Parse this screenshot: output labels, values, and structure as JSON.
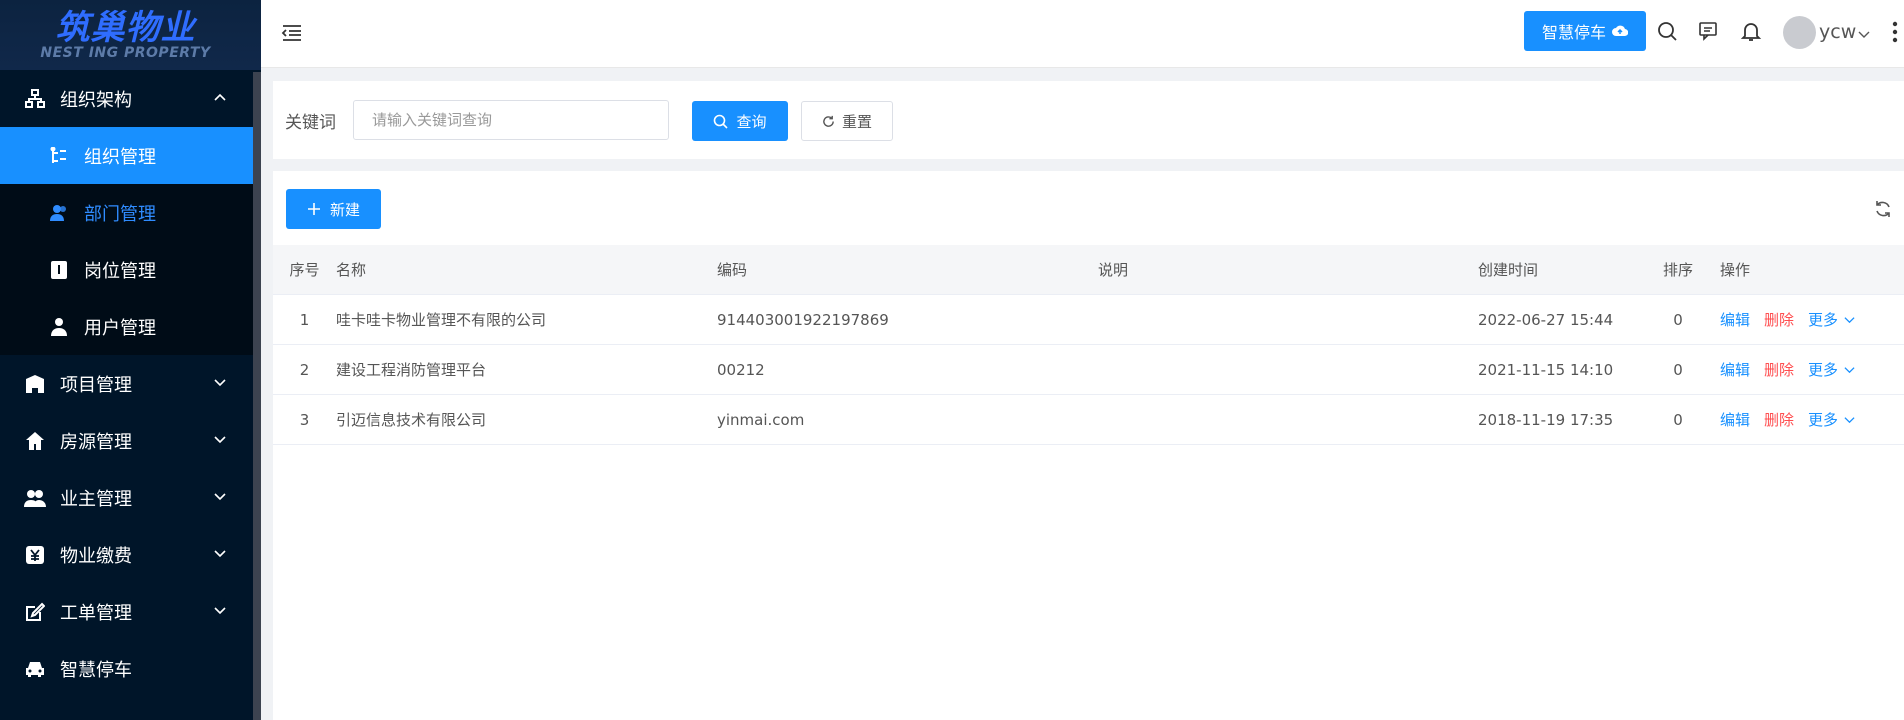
{
  "brand": {
    "logo_cn": "筑巢物业",
    "logo_en": "NEST ING PROPERTY"
  },
  "sidebar": {
    "items": [
      {
        "label": "组织架构",
        "icon": "org-chart-icon",
        "expanded": true
      },
      {
        "label": "组织管理",
        "icon": "tree-icon",
        "active": true
      },
      {
        "label": "部门管理",
        "icon": "users-icon"
      },
      {
        "label": "岗位管理",
        "icon": "badge-icon"
      },
      {
        "label": "用户管理",
        "icon": "user-icon"
      },
      {
        "label": "项目管理",
        "icon": "building-icon"
      },
      {
        "label": "房源管理",
        "icon": "home-icon"
      },
      {
        "label": "业主管理",
        "icon": "owners-icon"
      },
      {
        "label": "物业缴费",
        "icon": "yuan-icon"
      },
      {
        "label": "工单管理",
        "icon": "edit-icon"
      },
      {
        "label": "智慧停车",
        "icon": "car-icon"
      }
    ]
  },
  "header": {
    "park_button": "智慧停车",
    "username": "ycw"
  },
  "search": {
    "label": "关键词",
    "placeholder": "请输入关键词查询",
    "query_button": "查询",
    "reset_button": "重置"
  },
  "toolbar": {
    "new_button": "新建"
  },
  "table": {
    "columns": [
      "序号",
      "名称",
      "编码",
      "说明",
      "创建时间",
      "排序",
      "操作"
    ],
    "rows": [
      {
        "idx": "1",
        "name": "哇卡哇卡物业管理不有限的公司",
        "code": "914403001922197869",
        "desc": "",
        "time": "2022-06-27 15:44",
        "sort": "0"
      },
      {
        "idx": "2",
        "name": "建设工程消防管理平台",
        "code": "00212",
        "desc": "",
        "time": "2021-11-15 14:10",
        "sort": "0"
      },
      {
        "idx": "3",
        "name": "引迈信息技术有限公司",
        "code": "yinmai.com",
        "desc": "",
        "time": "2018-11-19 17:35",
        "sort": "0"
      }
    ],
    "ops": {
      "edit": "编辑",
      "delete": "删除",
      "more": "更多"
    }
  },
  "colors": {
    "primary": "#1890ff",
    "danger": "#ff4d4f",
    "sidebar_bg": "#001529"
  }
}
